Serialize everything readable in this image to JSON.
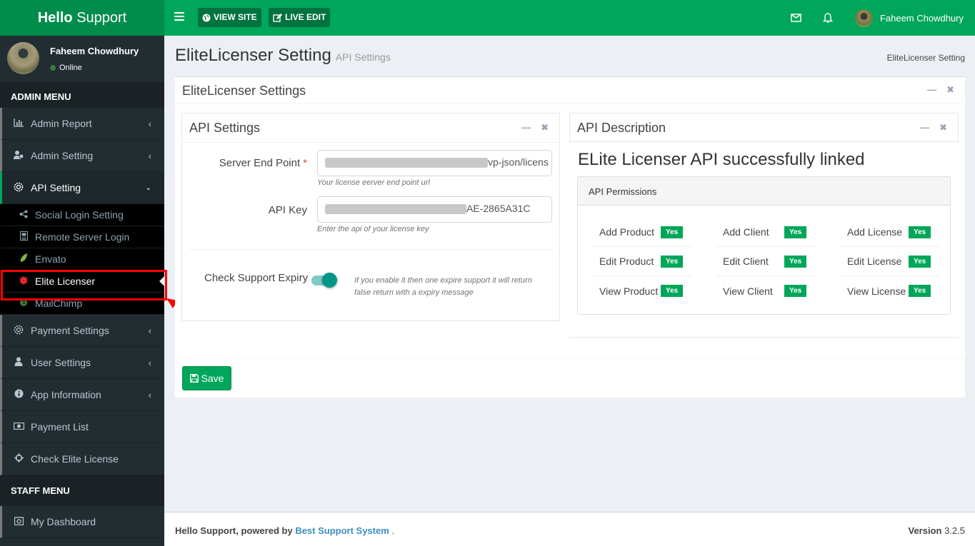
{
  "app": {
    "logo_bold": "Hello",
    "logo_rest": " Support"
  },
  "topbar": {
    "view_site": "VIEW SITE",
    "live_edit": "LIVE EDIT",
    "user_name": "Faheem Chowdhury"
  },
  "sidebar": {
    "user_name": "Faheem Chowdhury",
    "status": "Online",
    "admin_header": "ADMIN MENU",
    "staff_header": "STAFF MENU",
    "items": [
      {
        "label": "Admin Report",
        "icon": "bar-chart-icon",
        "expandable": true
      },
      {
        "label": "Admin Setting",
        "icon": "users-cog-icon",
        "expandable": true
      },
      {
        "label": "API Setting",
        "icon": "gear-icon",
        "expandable": true,
        "expanded": true
      },
      {
        "label": "Payment Settings",
        "icon": "gear-icon",
        "expandable": true
      },
      {
        "label": "User Settings",
        "icon": "user-icon",
        "expandable": true
      },
      {
        "label": "App Information",
        "icon": "info-icon",
        "expandable": true
      },
      {
        "label": "Payment List",
        "icon": "money-icon",
        "expandable": false
      },
      {
        "label": "Check Elite License",
        "icon": "crosshair-icon",
        "expandable": false
      }
    ],
    "sub_items": [
      {
        "label": "Social Login Setting",
        "icon": "share-icon"
      },
      {
        "label": "Remote Server Login",
        "icon": "server-icon"
      },
      {
        "label": "Envato",
        "icon": "leaf-icon"
      },
      {
        "label": "Elite Licenser",
        "icon": "shield-icon",
        "active": true
      },
      {
        "label": "MailChimp",
        "icon": "mailchimp-icon"
      }
    ],
    "staff_items": [
      {
        "label": "My Dashboard",
        "icon": "camera-icon"
      }
    ]
  },
  "page": {
    "title": "EliteLicenser Setting",
    "subtitle": "API Settings",
    "breadcrumb": "EliteLicenser Setting"
  },
  "main_box": {
    "title": "EliteLicenser Settings"
  },
  "api_settings": {
    "title": "API Settings",
    "server_end_point": {
      "label": "Server End Point",
      "required": "*",
      "visible_value": "vp-json/licens",
      "help": "Your license eerver end point url"
    },
    "api_key": {
      "label": "API Key",
      "visible_value": "AE-2865A31C",
      "help": "Enter the api of your license key"
    },
    "check_support_expiry": {
      "label": "Check Support Expiry",
      "enabled": true,
      "help": "If you enable it then one expire support it will return false return with a expiry message"
    }
  },
  "api_description": {
    "title": "API Description",
    "message": "ELite Licenser API successfully linked",
    "permissions_title": "API Permissions",
    "permissions": [
      {
        "label": "Add Product",
        "value": "Yes"
      },
      {
        "label": "Add Client",
        "value": "Yes"
      },
      {
        "label": "Add License",
        "value": "Yes"
      },
      {
        "label": "Edit Product",
        "value": "Yes"
      },
      {
        "label": "Edit Client",
        "value": "Yes"
      },
      {
        "label": "Edit License",
        "value": "Yes"
      },
      {
        "label": "View Product",
        "value": "Yes"
      },
      {
        "label": "View Client",
        "value": "Yes"
      },
      {
        "label": "View License",
        "value": "Yes"
      }
    ]
  },
  "actions": {
    "save": "Save"
  },
  "footer": {
    "brand": "Hello Support, powered by",
    "link": "Best Support System",
    "suffix": ".",
    "version_label": "Version",
    "version": "3.2.5"
  },
  "colors": {
    "primary": "#00a65a",
    "sidebar": "#222d32",
    "highlight": "#ff0000",
    "toggle": "#009688"
  }
}
